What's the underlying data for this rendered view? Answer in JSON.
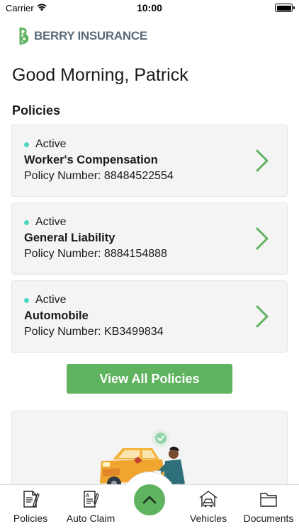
{
  "status_bar": {
    "carrier": "Carrier",
    "time": "10:00"
  },
  "brand": {
    "name": "BERRY INSURANCE",
    "accent_color": "#5fb35f",
    "icon": "berry-logo-icon"
  },
  "greeting": "Good Morning, Patrick",
  "policies": {
    "title": "Policies",
    "items": [
      {
        "status": "Active",
        "name": "Worker's Compensation",
        "number": "Policy Number: 88484522554"
      },
      {
        "status": "Active",
        "name": "General Liability",
        "number": "Policy Number: 8884154888"
      },
      {
        "status": "Active",
        "name": "Automobile",
        "number": "Policy Number: KB3499834"
      }
    ],
    "view_all_label": "View All Policies",
    "status_color": "#4fd6c2"
  },
  "tab_bar": {
    "tabs": [
      {
        "label": "Policies",
        "icon": "policy-document-icon"
      },
      {
        "label": "Auto Claim",
        "icon": "auto-claim-form-icon"
      },
      {
        "label": "Vehicles",
        "icon": "garage-car-icon"
      },
      {
        "label": "Documents",
        "icon": "folder-icon"
      }
    ],
    "center_icon": "chevron-up-icon"
  }
}
